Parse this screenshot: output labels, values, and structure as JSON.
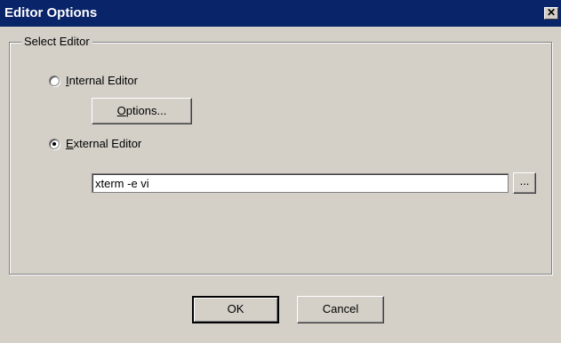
{
  "window": {
    "title": "Editor Options",
    "close_glyph": "✕"
  },
  "group": {
    "label": "Select Editor"
  },
  "internal": {
    "accel": "I",
    "rest": "nternal Editor",
    "checked": false
  },
  "options_button": {
    "accel": "O",
    "rest": "ptions..."
  },
  "external": {
    "accel": "E",
    "rest": "xternal Editor",
    "checked": true
  },
  "editor_command": {
    "value": "xterm -e vi"
  },
  "browse_button": {
    "label": "..."
  },
  "footer": {
    "ok_label": "OK",
    "cancel_label": "Cancel"
  },
  "colors": {
    "titlebar": "#0a246a",
    "face": "#d4d0c8"
  }
}
